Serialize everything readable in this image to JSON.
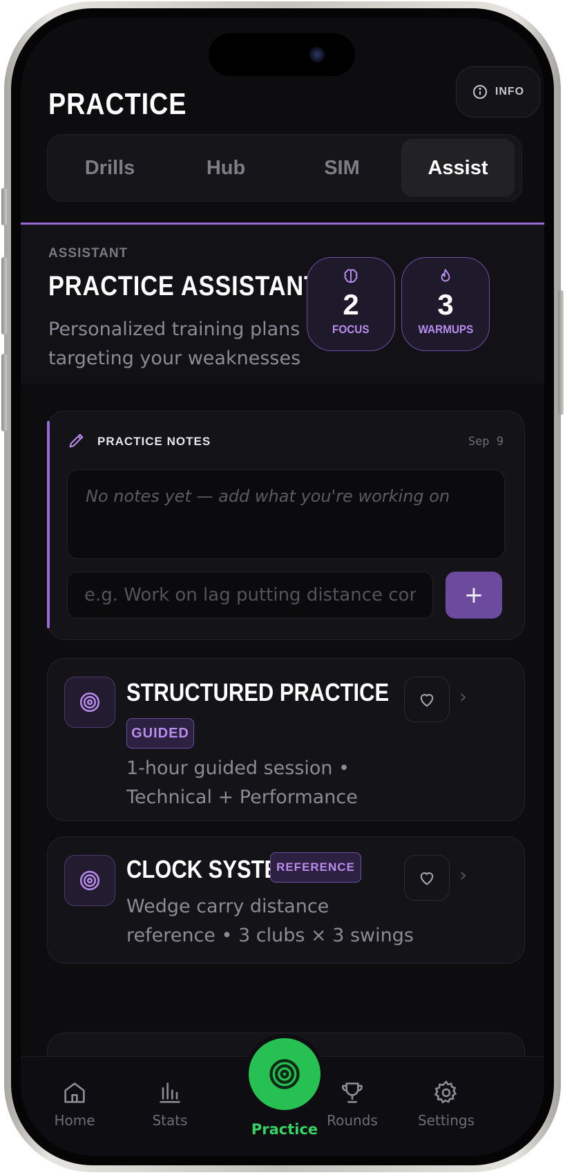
{
  "header": {
    "title": "PRACTICE",
    "info_label": "INFO"
  },
  "tabs": [
    {
      "label": "Drills",
      "active": false
    },
    {
      "label": "Hub",
      "active": false
    },
    {
      "label": "SIM",
      "active": false
    },
    {
      "label": "Assist",
      "active": true
    }
  ],
  "hero": {
    "kicker": "ASSISTANT",
    "title": "PRACTICE ASSISTANT",
    "subtitle": "Personalized training plans targeting your weaknesses",
    "stats": [
      {
        "icon": "brain-icon",
        "value": "2",
        "label": "FOCUS"
      },
      {
        "icon": "flame-icon",
        "value": "3",
        "label": "WARMUPS"
      }
    ]
  },
  "notes": {
    "heading": "PRACTICE NOTES",
    "date": "Sep 9",
    "empty_text": "No notes yet — add what you're working on",
    "input_value": "",
    "input_placeholder": "e.g. Work on lag putting distance control",
    "add_label": "+"
  },
  "cards": [
    {
      "title": "STRUCTURED PRACTICE",
      "badge": "GUIDED",
      "description": "1-hour guided session • Technical + Performance",
      "icon": "target-icon"
    },
    {
      "title": "CLOCK SYSTEM",
      "badge": "REFERENCE",
      "description": "Wedge carry distance reference • 3 clubs × 3 swings",
      "icon": "target-icon"
    }
  ],
  "nav": {
    "items": [
      {
        "label": "Home",
        "icon": "home-icon"
      },
      {
        "label": "Stats",
        "icon": "bar-chart-icon"
      },
      {
        "label": "Practice",
        "icon": "target-icon",
        "active": true
      },
      {
        "label": "Rounds",
        "icon": "trophy-icon"
      },
      {
        "label": "Settings",
        "icon": "gear-icon"
      }
    ]
  },
  "colors": {
    "accent": "#9a6ad8",
    "active_green": "#27c153",
    "background": "#0d0c0f"
  }
}
